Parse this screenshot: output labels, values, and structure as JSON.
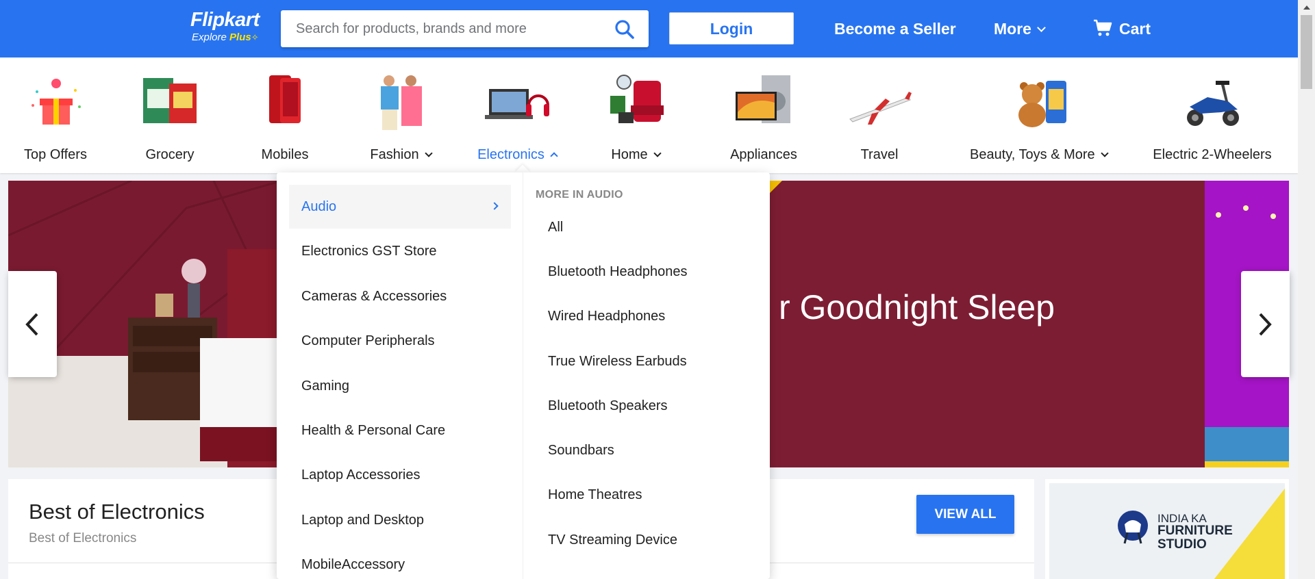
{
  "header": {
    "logo_main": "Flipkart",
    "logo_sub_explore": "Explore",
    "logo_sub_plus": "Plus",
    "search_placeholder": "Search for products, brands and more",
    "login_label": "Login",
    "seller_label": "Become a Seller",
    "more_label": "More",
    "cart_label": "Cart"
  },
  "categories": [
    {
      "label": "Top Offers",
      "has_chevron": false
    },
    {
      "label": "Grocery",
      "has_chevron": false
    },
    {
      "label": "Mobiles",
      "has_chevron": false
    },
    {
      "label": "Fashion",
      "has_chevron": true
    },
    {
      "label": "Electronics",
      "has_chevron": true,
      "active": true
    },
    {
      "label": "Home",
      "has_chevron": true
    },
    {
      "label": "Appliances",
      "has_chevron": false
    },
    {
      "label": "Travel",
      "has_chevron": false
    },
    {
      "label": "Beauty, Toys & More",
      "has_chevron": true
    },
    {
      "label": "Electric 2-Wheelers",
      "has_chevron": false
    }
  ],
  "banner": {
    "text": "r Goodnight Sleep"
  },
  "dropdown": {
    "left_items": [
      "Audio",
      "Electronics GST Store",
      "Cameras & Accessories",
      "Computer Peripherals",
      "Gaming",
      "Health & Personal Care",
      "Laptop Accessories",
      "Laptop and Desktop",
      "MobileAccessory"
    ],
    "active_item": "Audio",
    "right_heading": "MORE IN AUDIO",
    "right_items": [
      "All",
      "Bluetooth Headphones",
      "Wired Headphones",
      "True Wireless Earbuds",
      "Bluetooth Speakers",
      "Soundbars",
      "Home Theatres",
      "TV Streaming Device"
    ]
  },
  "best": {
    "title": "Best of Electronics",
    "subtitle": "Best of Electronics",
    "view_all": "VIEW ALL"
  },
  "ad": {
    "line1": "INDIA KA",
    "line2": "FURNITURE STUDIO"
  },
  "colors": {
    "brand_blue": "#2874f0",
    "accent_yellow": "#ffe500",
    "banner_maroon": "#7d1d33"
  }
}
